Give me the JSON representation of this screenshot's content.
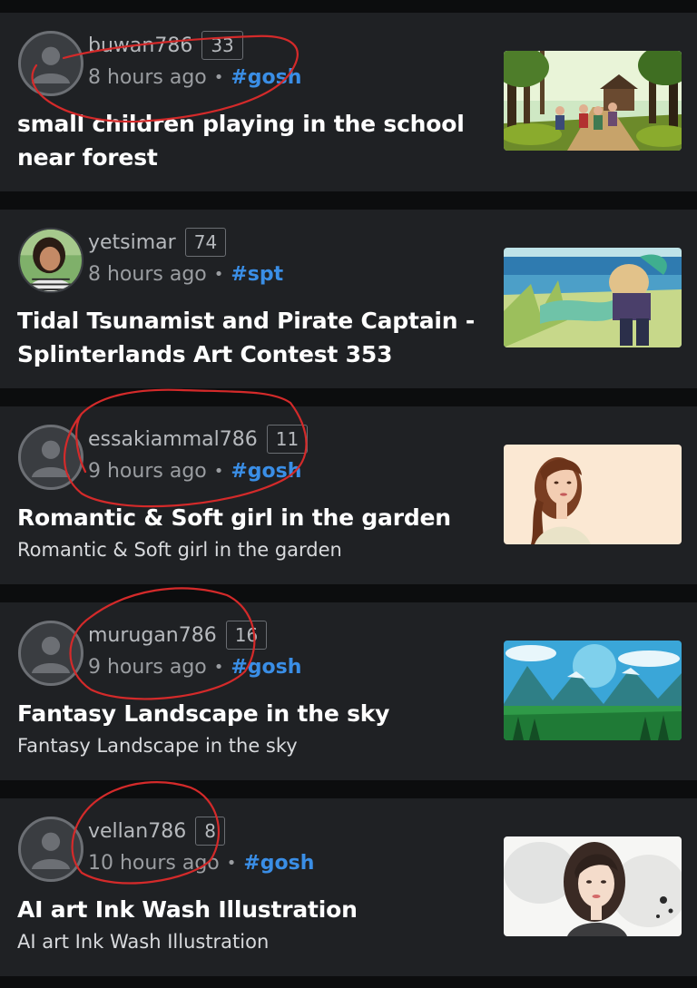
{
  "feed": {
    "posts": [
      {
        "username": "buwan786",
        "reputation": "33",
        "time": "8 hours ago",
        "separator": "•",
        "tag": "#gosh",
        "title": "small children playing in the school near forest",
        "summary": "",
        "avatar": "default-user-icon",
        "thumbnail": "forest-school-children-image"
      },
      {
        "username": "yetsimar",
        "reputation": "74",
        "time": "8 hours ago",
        "separator": "•",
        "tag": "#spt",
        "title": "Tidal Tsunamist and Pirate Captain - Splinterlands Art Contest 353",
        "summary": "",
        "avatar": "user-photo",
        "thumbnail": "mermaid-pirate-art-image"
      },
      {
        "username": "essakiammal786",
        "reputation": "11",
        "time": "9 hours ago",
        "separator": "•",
        "tag": "#gosh",
        "title": "Romantic & Soft girl in the garden",
        "summary": "Romantic & Soft girl in the garden",
        "avatar": "default-user-icon",
        "thumbnail": "girl-portrait-image"
      },
      {
        "username": "murugan786",
        "reputation": "16",
        "time": "9 hours ago",
        "separator": "•",
        "tag": "#gosh",
        "title": "Fantasy Landscape in the sky",
        "summary": "Fantasy Landscape in the sky",
        "avatar": "default-user-icon",
        "thumbnail": "fantasy-landscape-image"
      },
      {
        "username": "vellan786",
        "reputation": "8",
        "time": "10 hours ago",
        "separator": "•",
        "tag": "#gosh",
        "title": "AI art Ink Wash Illustration",
        "summary": "AI art Ink Wash Illustration",
        "avatar": "default-user-icon",
        "thumbnail": "ink-wash-portrait-image"
      }
    ]
  },
  "colors": {
    "page_background": "#0c0d0e",
    "card_background": "#1f2124",
    "tag_link": "#3a8ee6",
    "title_text": "#ffffff",
    "meta_text": "#b6b9bd",
    "annotation_ink": "#d42a2a"
  }
}
